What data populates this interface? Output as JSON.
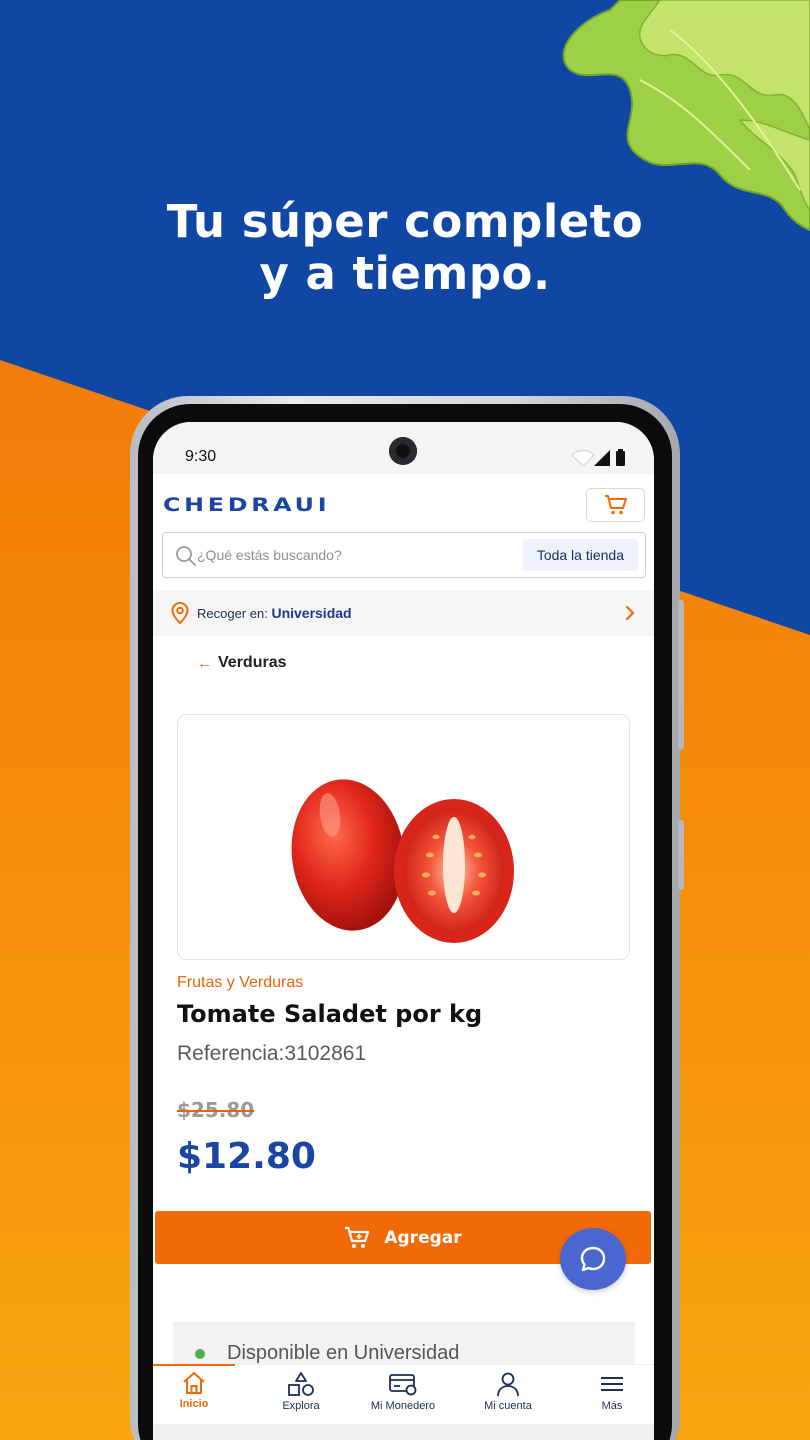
{
  "promo": {
    "headline_line1": "Tu súper completo",
    "headline_line2": "y a tiempo."
  },
  "status_bar": {
    "time": "9:30"
  },
  "header": {
    "logo": "CHEDRAUI",
    "cart_icon": "cart-icon"
  },
  "search": {
    "placeholder": "¿Qué estás buscando?",
    "store_scope": "Toda la tienda"
  },
  "pickup": {
    "label": "Recoger en:",
    "store": "Universidad"
  },
  "breadcrumb": {
    "back_label": "Verduras"
  },
  "product": {
    "category": "Frutas y Verduras",
    "title": "Tomate Saladet por kg",
    "reference": "Referencia:3102861",
    "old_price": "$25.80",
    "price": "$12.80",
    "image_icon": "tomato-image"
  },
  "actions": {
    "add_label": "Agregar"
  },
  "availability": {
    "text": "Disponible en Universidad"
  },
  "bottom_nav": {
    "items": [
      {
        "label": "Inicio",
        "icon": "home-icon",
        "active": true
      },
      {
        "label": "Explora",
        "icon": "shapes-icon"
      },
      {
        "label": "Mi Monedero",
        "icon": "wallet-icon"
      },
      {
        "label": "Mi cuenta",
        "icon": "user-icon"
      },
      {
        "label": "Más",
        "icon": "menu-icon"
      }
    ]
  },
  "colors": {
    "brand_blue": "#1a45a3",
    "brand_orange": "#f26a08",
    "chat_blue": "#4a67d0",
    "available_green": "#4caf50"
  }
}
